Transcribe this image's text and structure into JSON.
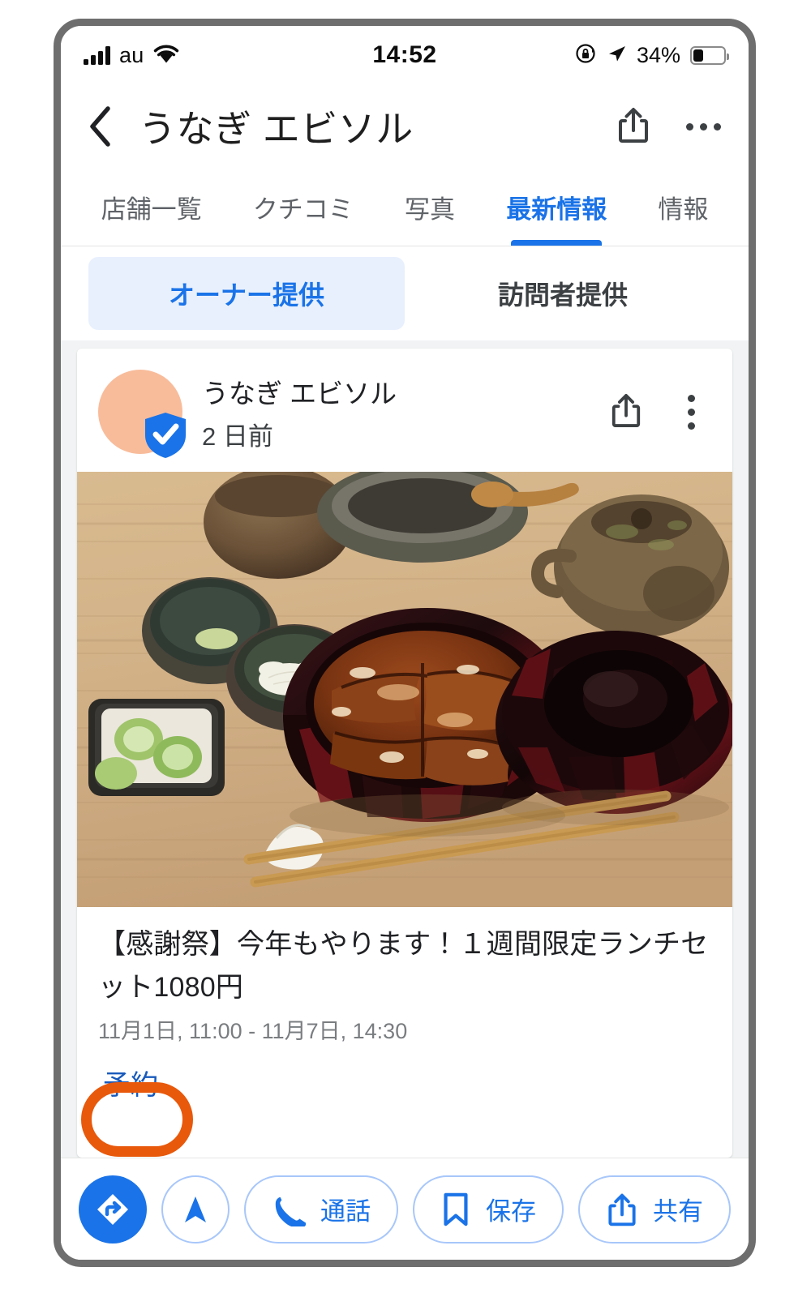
{
  "status_bar": {
    "carrier": "au",
    "time": "14:52",
    "battery_percent": "34%",
    "battery_level": 34,
    "icons": {
      "signal": "signal-bars-icon",
      "wifi": "wifi-icon",
      "rotation_lock": "rotation-lock-icon",
      "location": "location-arrow-icon",
      "battery": "battery-icon"
    }
  },
  "header": {
    "title": "うなぎ エビソル",
    "back_icon": "back-chevron-icon",
    "share_icon": "share-icon",
    "overflow_icon": "more-horizontal-icon"
  },
  "tabs": [
    {
      "label": "店舗一覧",
      "active": false
    },
    {
      "label": "クチコミ",
      "active": false
    },
    {
      "label": "写真",
      "active": false
    },
    {
      "label": "最新情報",
      "active": true
    },
    {
      "label": "情報",
      "active": false
    }
  ],
  "segments": [
    {
      "label": "オーナー提供",
      "selected": true
    },
    {
      "label": "訪問者提供",
      "selected": false
    }
  ],
  "post": {
    "author": "うなぎ エビソル",
    "time_ago": "2 日前",
    "verified_icon": "verified-shield-icon",
    "share_icon": "share-icon",
    "overflow_icon": "more-vertical-icon",
    "photo_alt": "unagi-donburi-photo",
    "title": "【感謝祭】今年もやります！１週間限定ランチセット1080円",
    "date_range": "11月1日, 11:00 - 11月7日, 14:30",
    "cta_label": "予約"
  },
  "annotation": {
    "shape": "circle",
    "color": "#e8590c",
    "targets": "予約"
  },
  "bottom_bar": {
    "directions_icon": "directions-icon",
    "navigate_icon": "navigation-arrow-icon",
    "buttons": [
      {
        "label": "通話",
        "icon": "phone-icon"
      },
      {
        "label": "保存",
        "icon": "bookmark-icon"
      },
      {
        "label": "共有",
        "icon": "share-icon"
      }
    ]
  },
  "colors": {
    "accent_blue": "#1a73e8",
    "link_blue": "#185abc",
    "segment_bg": "#e8f0fe",
    "annotation_orange": "#e8590c",
    "avatar_peach": "#f8bc9b",
    "frame_gray": "#6e6e6e"
  }
}
